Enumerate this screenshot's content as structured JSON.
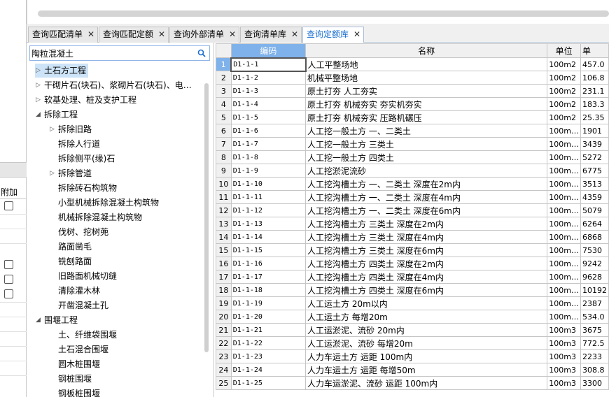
{
  "tabs": [
    {
      "label": "查询匹配清单",
      "close": "✕"
    },
    {
      "label": "查询匹配定额",
      "close": "✕"
    },
    {
      "label": "查询外部清单",
      "close": "✕"
    },
    {
      "label": "查询清单库",
      "close": "✕"
    },
    {
      "label": "查询定额库",
      "close": "✕"
    }
  ],
  "active_tab": "查询定额库",
  "left_strip": {
    "header": "附加"
  },
  "search": {
    "value": "陶粒混凝土",
    "icon": "search-icon"
  },
  "tree": [
    {
      "label": "土石方工程",
      "level": 0,
      "expander": "collapsed",
      "selected": true
    },
    {
      "label": "干砌片石(块石)、浆砌片石(块石)、电…",
      "level": 0,
      "expander": "collapsed"
    },
    {
      "label": "软基处理、桩及支护工程",
      "level": 0,
      "expander": "collapsed"
    },
    {
      "label": "拆除工程",
      "level": 0,
      "expander": "expanded"
    },
    {
      "label": "拆除旧路",
      "level": 1,
      "expander": "collapsed"
    },
    {
      "label": "拆除人行道",
      "level": 1,
      "expander": "none"
    },
    {
      "label": "拆除侧平(缘)石",
      "level": 1,
      "expander": "none"
    },
    {
      "label": "拆除管道",
      "level": 1,
      "expander": "collapsed"
    },
    {
      "label": "拆除砖石构筑物",
      "level": 1,
      "expander": "none"
    },
    {
      "label": "小型机械拆除混凝土构筑物",
      "level": 1,
      "expander": "none"
    },
    {
      "label": "机械拆除混凝土构筑物",
      "level": 1,
      "expander": "none"
    },
    {
      "label": "伐树、挖树蔸",
      "level": 1,
      "expander": "none"
    },
    {
      "label": "路面凿毛",
      "level": 1,
      "expander": "none"
    },
    {
      "label": "铣刨路面",
      "level": 1,
      "expander": "none"
    },
    {
      "label": "旧路面机械切缝",
      "level": 1,
      "expander": "none"
    },
    {
      "label": "清除灌木林",
      "level": 1,
      "expander": "none"
    },
    {
      "label": "开凿混凝土孔",
      "level": 1,
      "expander": "none"
    },
    {
      "label": "围堰工程",
      "level": 0,
      "expander": "expanded"
    },
    {
      "label": "土、纤维袋围堰",
      "level": 1,
      "expander": "none"
    },
    {
      "label": "土石混合围堰",
      "level": 1,
      "expander": "none"
    },
    {
      "label": "圆木桩围堰",
      "level": 1,
      "expander": "none"
    },
    {
      "label": "钢桩围堰",
      "level": 1,
      "expander": "none"
    },
    {
      "label": "钢板桩围堰",
      "level": 1,
      "expander": "none"
    }
  ],
  "grid": {
    "columns": [
      "编码",
      "名称",
      "单位",
      "单"
    ],
    "rows": [
      [
        "1",
        "D1-1-1",
        "人工平整场地",
        "100m2",
        "457.0"
      ],
      [
        "2",
        "D1-1-2",
        "机械平整场地",
        "100m2",
        "106.8"
      ],
      [
        "3",
        "D1-1-3",
        "原土打夯 人工夯实",
        "100m2",
        "231.1"
      ],
      [
        "4",
        "D1-1-4",
        "原土打夯 机械夯实 夯实机夯实",
        "100m2",
        "183.3"
      ],
      [
        "5",
        "D1-1-5",
        "原土打夯 机械夯实 压路机碾压",
        "100m2",
        "25.35"
      ],
      [
        "6",
        "D1-1-6",
        "人工挖一般土方 一、二类土",
        "100m…",
        "1901"
      ],
      [
        "7",
        "D1-1-7",
        "人工挖一般土方 三类土",
        "100m…",
        "3439"
      ],
      [
        "8",
        "D1-1-8",
        "人工挖一般土方 四类土",
        "100m…",
        "5272"
      ],
      [
        "9",
        "D1-1-9",
        "人工挖淤泥流砂",
        "100m…",
        "6775"
      ],
      [
        "10",
        "D1-1-10",
        "人工挖沟槽土方 一、二类土 深度在2m内",
        "100m…",
        "3513"
      ],
      [
        "11",
        "D1-1-11",
        "人工挖沟槽土方 一、二类土 深度在4m内",
        "100m…",
        "4359"
      ],
      [
        "12",
        "D1-1-12",
        "人工挖沟槽土方 一、二类土 深度在6m内",
        "100m…",
        "5079"
      ],
      [
        "13",
        "D1-1-13",
        "人工挖沟槽土方 三类土 深度在2m内",
        "100m…",
        "6264"
      ],
      [
        "14",
        "D1-1-14",
        "人工挖沟槽土方 三类土 深度在4m内",
        "100m…",
        "6868"
      ],
      [
        "15",
        "D1-1-15",
        "人工挖沟槽土方 三类土 深度在6m内",
        "100m…",
        "7530"
      ],
      [
        "16",
        "D1-1-16",
        "人工挖沟槽土方 四类土 深度在2m内",
        "100m…",
        "9242"
      ],
      [
        "17",
        "D1-1-17",
        "人工挖沟槽土方 四类土 深度在4m内",
        "100m…",
        "9628"
      ],
      [
        "18",
        "D1-1-18",
        "人工挖沟槽土方 四类土 深度在6m内",
        "100m…",
        "10192"
      ],
      [
        "19",
        "D1-1-19",
        "人工运土方 20m以内",
        "100m…",
        "2387"
      ],
      [
        "20",
        "D1-1-20",
        "人工运土方 每增20m",
        "100m…",
        "534.0"
      ],
      [
        "21",
        "D1-1-21",
        "人工运淤泥、流砂 20m内",
        "100m3",
        "3675"
      ],
      [
        "22",
        "D1-1-22",
        "人工运淤泥、流砂 每增20m",
        "100m3",
        "772.5"
      ],
      [
        "23",
        "D1-1-23",
        "人力车运土方 运距 100m内",
        "100m3",
        "2233"
      ],
      [
        "24",
        "D1-1-24",
        "人力车运土方 运距 每增50m",
        "100m3",
        "308.8"
      ],
      [
        "25",
        "D1-1-25",
        "人力车运淤泥、流砂 运距 100m内",
        "100m3",
        "3300"
      ]
    ]
  }
}
